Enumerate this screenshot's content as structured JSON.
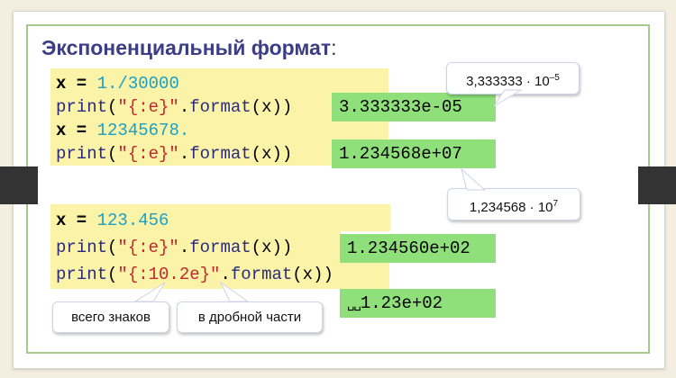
{
  "title": {
    "main": "Экспоненциальный формат",
    "colon": ":"
  },
  "block1": {
    "line1": {
      "var": "x",
      "op": " = ",
      "value": "1./30000"
    },
    "line2": {
      "func": "print",
      "open": "(",
      "str": "\"{:e}\"",
      "dot": ".",
      "method": "format",
      "args": "(x))"
    },
    "line3": {
      "var": "x",
      "op": " = ",
      "value": "12345678."
    },
    "line4": {
      "func": "print",
      "open": "(",
      "str": "\"{:e}\"",
      "dot": ".",
      "method": "format",
      "args": "(x))"
    },
    "output1": "3.333333e-05",
    "output2": "1.234568e+07"
  },
  "callout1": {
    "mantissa": "3,333333 · 10",
    "exponent": "–5"
  },
  "callout2": {
    "mantissa": "1,234568 · 10",
    "exponent": "7"
  },
  "block2": {
    "line1": {
      "var": "x",
      "op": " = ",
      "value": "123.456"
    },
    "line2": {
      "func": "print",
      "open": "(",
      "str": "\"{:e}\"",
      "dot": ".",
      "method": "format",
      "args": "(x))"
    },
    "line3": {
      "func": "print",
      "open": "(",
      "str": "\"{:10.2e}\"",
      "dot": ".",
      "method": "format",
      "args": "(x))"
    },
    "output1": "1.234560e+02",
    "output2_spaces": "␣␣",
    "output2": "1.23e+02"
  },
  "label_total": "всего знаков",
  "label_fraction": "в дробной части",
  "colors": {
    "title": "#3d3d86",
    "code_bg": "#fbf3a7",
    "output_bg": "#8fe07a",
    "string": "#c1272d",
    "number": "#1aa0c8",
    "frame": "#a9c88f"
  }
}
